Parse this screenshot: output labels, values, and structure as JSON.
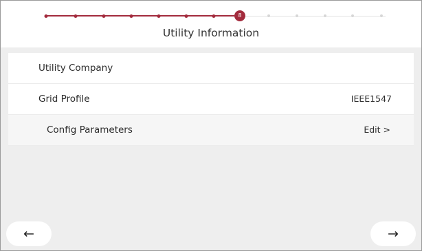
{
  "header": {
    "title": "Utility Information",
    "current_step": "8",
    "accent_color": "#a32b3d",
    "total_steps": 13,
    "completed_steps": 7
  },
  "rows": [
    {
      "label": "Utility Company",
      "value": ""
    },
    {
      "label": "Grid Profile",
      "value": "IEEE1547"
    },
    {
      "label": "Config Parameters",
      "value": "Edit >"
    }
  ],
  "nav": {
    "back_icon": "arrow-left-icon",
    "next_icon": "arrow-right-icon",
    "back_glyph": "←",
    "next_glyph": "→"
  }
}
